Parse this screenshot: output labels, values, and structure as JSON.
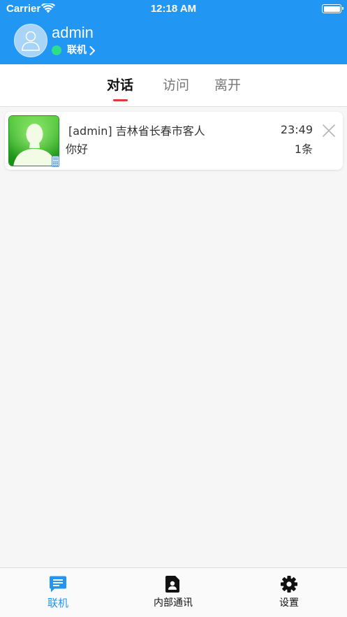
{
  "status_bar": {
    "carrier": "Carrier",
    "time": "12:18 AM"
  },
  "user": {
    "name": "admin",
    "status": "联机",
    "status_color": "#2ddf8a"
  },
  "tabs": [
    {
      "label": "对话",
      "active": true
    },
    {
      "label": "访问",
      "active": false
    },
    {
      "label": "离开",
      "active": false
    }
  ],
  "conversations": [
    {
      "title": "[admin] 吉林省长春市客人",
      "time": "23:49",
      "message": "你好",
      "count": "1条",
      "avatar_icon": "person-silhouette-icon",
      "device_icon": "mobile-phone-icon"
    }
  ],
  "bottom_nav": [
    {
      "label": "联机",
      "icon": "chat-bubble-icon",
      "active": true
    },
    {
      "label": "内部通讯",
      "icon": "contact-card-icon",
      "active": false
    },
    {
      "label": "设置",
      "icon": "gear-icon",
      "active": false
    }
  ],
  "colors": {
    "primary": "#2196f3",
    "tab_indicator": "#e53935",
    "background": "#f6f6f6"
  }
}
